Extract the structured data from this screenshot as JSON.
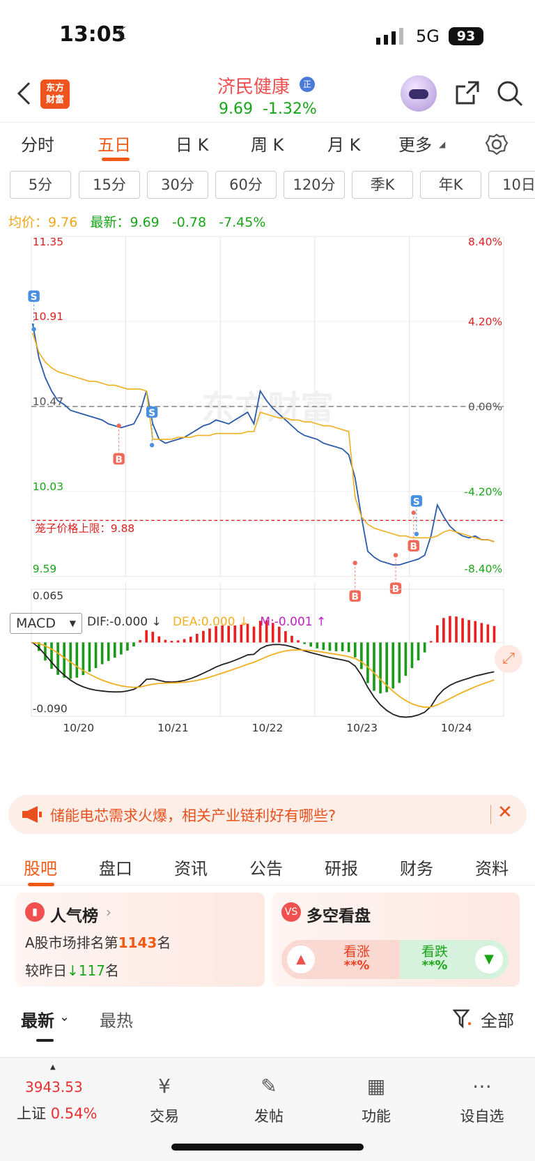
{
  "status_bar": {
    "time": "13:05",
    "network": "5G",
    "battery": "93"
  },
  "header": {
    "logo_line1": "东方",
    "logo_line2": "财富",
    "stock_name": "济民健康",
    "badge": "正",
    "price": "9.69",
    "change_pct": "-1.32%"
  },
  "period_tabs": [
    "分时",
    "五日",
    "日 K",
    "周 K",
    "月 K",
    "更多"
  ],
  "active_period": "五日",
  "kline_options": [
    "5分",
    "15分",
    "30分",
    "60分",
    "120分",
    "季K",
    "年K",
    "10日"
  ],
  "indicator": {
    "avg_label": "均价：",
    "avg_value": "9.76",
    "latest_label": "最新：",
    "latest_value": "9.69",
    "latest_change": "-0.78",
    "latest_pct": "-7.45%"
  },
  "chart_data": [
    {
      "type": "line",
      "y_labels_left": [
        "11.35",
        "10.91",
        "10.47",
        "10.03",
        "9.88",
        "9.59"
      ],
      "y_labels_right": [
        "8.40%",
        "4.20%",
        "0.00%",
        "-4.20%",
        "-8.40%"
      ],
      "x_labels": [
        "10/20",
        "10/21",
        "10/22",
        "10/23",
        "10/24"
      ],
      "ylim": [
        9.59,
        11.35
      ],
      "reference_line": {
        "label": "笼子价格上限：",
        "value": "9.88"
      },
      "prev_close": 10.47,
      "watermark": "东方财富",
      "series": [
        {
          "name": "price",
          "color": "#2a5caa",
          "values": [
            10.9,
            10.72,
            10.62,
            10.55,
            10.5,
            10.48,
            10.45,
            10.44,
            10.43,
            10.42,
            10.41,
            10.4,
            10.38,
            10.37,
            10.36,
            10.37,
            10.38,
            10.44,
            10.55,
            10.38,
            10.3,
            10.28,
            10.29,
            10.3,
            10.31,
            10.33,
            10.35,
            10.37,
            10.38,
            10.4,
            10.39,
            10.38,
            10.4,
            10.42,
            10.44,
            10.38,
            10.55,
            10.5,
            10.46,
            10.43,
            10.4,
            10.37,
            10.34,
            10.32,
            10.31,
            10.3,
            10.28,
            10.27,
            10.26,
            10.25,
            10.22,
            10.1,
            9.9,
            9.72,
            9.69,
            9.67,
            9.66,
            9.65,
            9.65,
            9.66,
            9.67,
            9.68,
            9.7,
            9.8,
            9.96,
            9.9,
            9.85,
            9.82,
            9.8,
            9.79,
            9.8,
            9.78,
            9.78,
            9.77
          ]
        },
        {
          "name": "avg",
          "color": "#f0b020",
          "values": [
            10.85,
            10.75,
            10.7,
            10.67,
            10.65,
            10.64,
            10.63,
            10.62,
            10.61,
            10.6,
            10.6,
            10.59,
            10.58,
            10.58,
            10.57,
            10.56,
            10.56,
            10.56,
            10.55,
            10.3,
            10.3,
            10.3,
            10.3,
            10.31,
            10.31,
            10.31,
            10.32,
            10.32,
            10.32,
            10.33,
            10.33,
            10.33,
            10.33,
            10.33,
            10.34,
            10.34,
            10.44,
            10.43,
            10.42,
            10.41,
            10.41,
            10.4,
            10.4,
            10.39,
            10.39,
            10.38,
            10.37,
            10.37,
            10.36,
            10.35,
            10.34,
            10.0,
            9.9,
            9.86,
            9.84,
            9.83,
            9.82,
            9.81,
            9.8,
            9.8,
            9.79,
            9.79,
            9.79,
            9.79,
            9.8,
            9.82,
            9.83,
            9.82,
            9.81,
            9.8,
            9.79,
            9.78,
            9.78,
            9.77
          ]
        }
      ],
      "trade_marks": [
        {
          "label": "S",
          "day": 0,
          "value": 10.87
        },
        {
          "label": "B",
          "day": 0.9,
          "value": 10.37
        },
        {
          "label": "S",
          "day": 1.25,
          "value": 10.27
        },
        {
          "label": "B",
          "day": 3.4,
          "value": 9.66
        },
        {
          "label": "B",
          "day": 3.83,
          "value": 9.7
        },
        {
          "label": "B",
          "day": 4.02,
          "value": 9.92
        },
        {
          "label": "S",
          "day": 4.05,
          "value": 9.81
        }
      ]
    },
    {
      "type": "bar",
      "title": "MACD",
      "dif_label": "DIF:-0.000",
      "dea_label": "DEA:0.000",
      "m_label": "M:-0.001",
      "ylim": [
        -0.09,
        0.065
      ],
      "y_labels": [
        "0.065",
        "-0.090"
      ]
    }
  ],
  "macd_colors": {
    "dif": "#222222",
    "dea": "#f0b020",
    "m": "#c020c0",
    "up": "#e82020",
    "down": "#1a9a1a"
  },
  "banner": {
    "text": "储能电芯需求火爆，相关产业链利好有哪些?"
  },
  "content_tabs": [
    "股吧",
    "盘口",
    "资讯",
    "公告",
    "研报",
    "财务",
    "资料"
  ],
  "active_content_tab": "股吧",
  "popularity": {
    "title": "人气榜",
    "rank_prefix": "A股市场排名第",
    "rank_value": "1143",
    "rank_suffix": "名",
    "change_prefix": "较昨日",
    "change_value": "117",
    "change_suffix": "名"
  },
  "sentiment": {
    "title": "多空看盘",
    "up_label": "看涨",
    "up_value": "**%",
    "down_label": "看跌",
    "down_value": "**%"
  },
  "sort": {
    "latest": "最新",
    "hot": "最热",
    "filter": "全部"
  },
  "bottom_nav": {
    "index_value": "3943.53",
    "index_name": "上证",
    "index_pct": "0.54%",
    "items": [
      "交易",
      "发帖",
      "功能",
      "设自选"
    ]
  }
}
